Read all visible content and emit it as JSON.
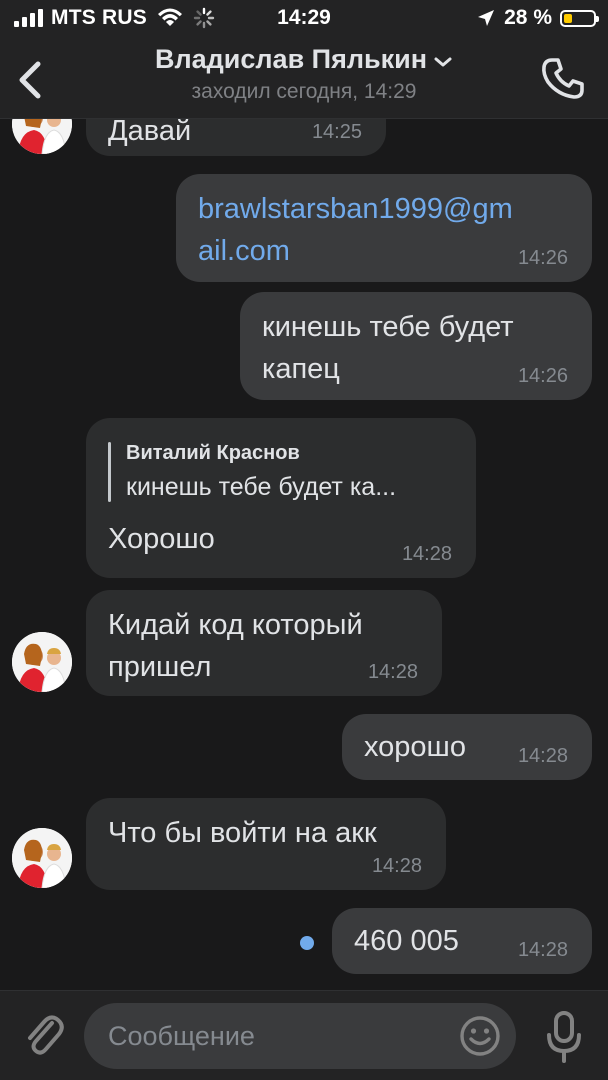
{
  "status_bar": {
    "carrier": "MTS RUS",
    "time": "14:29",
    "battery_percent": "28 %",
    "battery_level": 0.28,
    "battery_color": "#ffcc00"
  },
  "header": {
    "title": "Владислав Пялькин",
    "subtitle": "заходил сегодня, 14:29",
    "back_icon": "chevron-left-icon",
    "dropdown_icon": "chevron-down-icon",
    "call_icon": "phone-icon"
  },
  "messages": [
    {
      "direction": "in",
      "text": "Давай",
      "time": "14:25",
      "avatar": true
    },
    {
      "direction": "out",
      "text_line1": "brawlstarsban1999@gm",
      "text_line2": "ail.com",
      "is_link": true,
      "time": "14:26"
    },
    {
      "direction": "out",
      "text_line1": "кинешь тебе будет",
      "text_line2": "капец",
      "time": "14:26"
    },
    {
      "direction": "in",
      "reply_author": "Виталий Краснов",
      "reply_text": "кинешь тебе будет ка...",
      "text": "Хорошо",
      "time": "14:28"
    },
    {
      "direction": "in",
      "text_line1": "Кидай код который",
      "text_line2": "пришел",
      "time": "14:28",
      "avatar": true
    },
    {
      "direction": "out",
      "text": "хорошо",
      "time": "14:28"
    },
    {
      "direction": "in",
      "text": "Что бы войти на акк",
      "time": "14:28",
      "avatar": true
    },
    {
      "direction": "out",
      "text": "460 005",
      "time": "14:28",
      "unread": true
    }
  ],
  "composer": {
    "placeholder": "Сообщение",
    "attach_icon": "paperclip-icon",
    "emoji_icon": "smile-icon",
    "mic_icon": "microphone-icon"
  },
  "colors": {
    "background": "#19191a",
    "bar": "#232324",
    "bubble_in": "#2c2d2e",
    "bubble_out": "#3a3b3d",
    "link": "#71aaeb",
    "unread_dot": "#71aaeb"
  }
}
